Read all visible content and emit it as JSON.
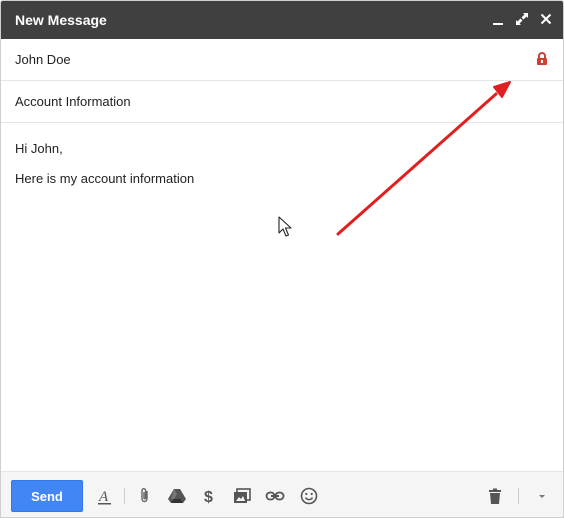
{
  "window": {
    "title": "New Message",
    "controls": [
      "minimize-icon",
      "expand-icon",
      "close-icon"
    ]
  },
  "recipient": {
    "value": "John Doe",
    "icon": "lock-icon",
    "icon_color": "#d23f31"
  },
  "subject": {
    "value": "Account Information"
  },
  "body": {
    "lines": [
      "Hi John,",
      "Here is my account information"
    ]
  },
  "toolbar": {
    "send_label": "Send",
    "send_color": "#4285f4",
    "icons": [
      "formatting-icon",
      "attach-icon",
      "drive-icon",
      "money-icon",
      "photo-icon",
      "link-icon",
      "emoji-icon",
      "trash-icon",
      "more-options-icon"
    ]
  },
  "annotation": {
    "arrow_color": "#e02020"
  }
}
